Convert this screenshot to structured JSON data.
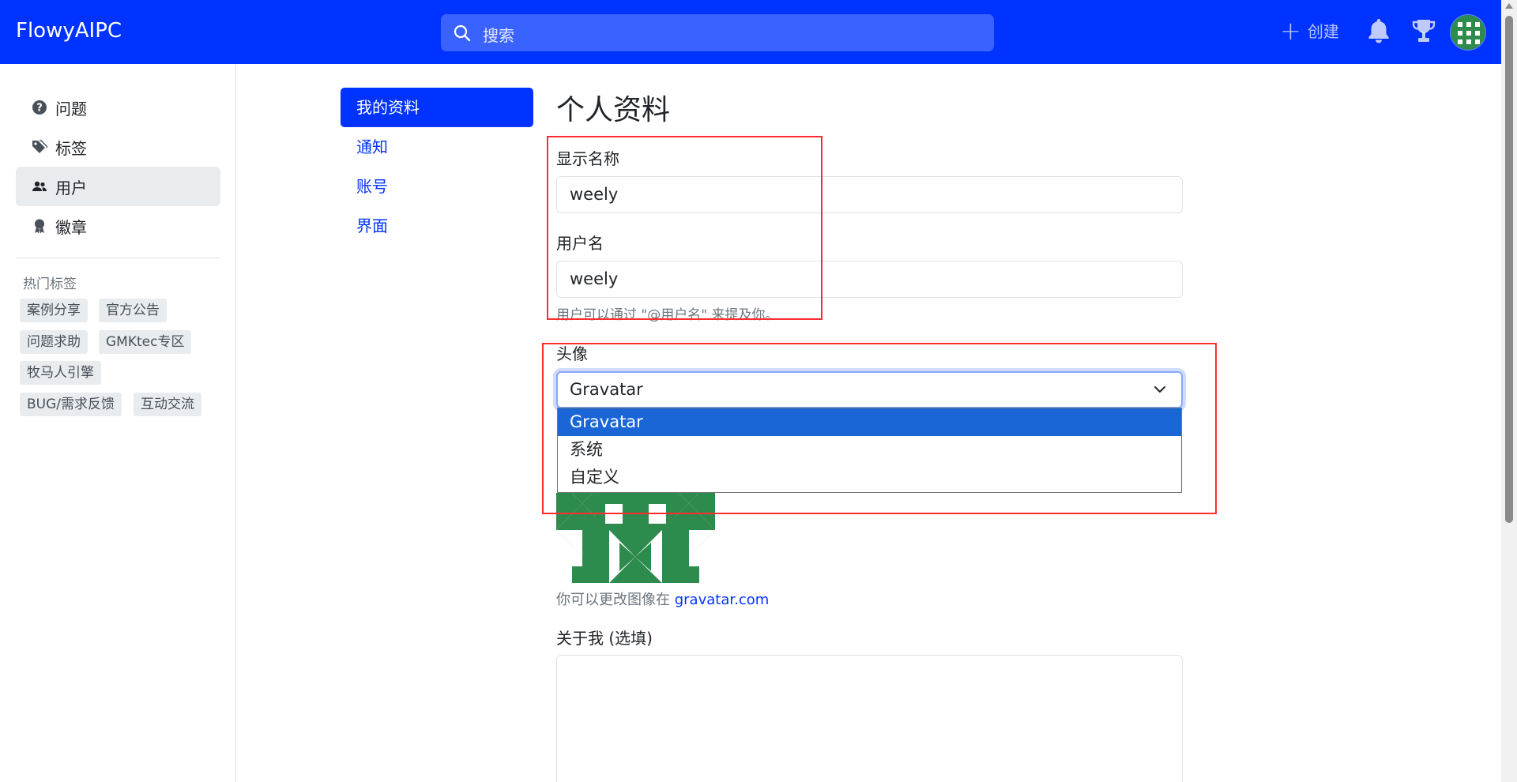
{
  "header": {
    "brand": "FlowyAIPC",
    "search_placeholder": "搜索",
    "create_label": "创建",
    "bar_color": "#0033ff"
  },
  "sidebar": {
    "items": [
      {
        "label": "问题",
        "icon": "question-circle-icon"
      },
      {
        "label": "标签",
        "icon": "tags-icon"
      },
      {
        "label": "用户",
        "icon": "people-icon",
        "active": true
      },
      {
        "label": "徽章",
        "icon": "award-icon"
      }
    ],
    "hot_tags_title": "热门标签",
    "hot_tags": [
      "案例分享",
      "官方公告",
      "问题求助",
      "GMKtec专区",
      "牧马人引擎",
      "BUG/需求反馈",
      "互动交流"
    ]
  },
  "settings_nav": {
    "items": [
      {
        "label": "我的资料",
        "active": true
      },
      {
        "label": "通知"
      },
      {
        "label": "账号"
      },
      {
        "label": "界面"
      }
    ]
  },
  "profile": {
    "title": "个人资料",
    "display_name_label": "显示名称",
    "display_name_value": "weely",
    "username_label": "用户名",
    "username_value": "weely",
    "username_hint": "用户可以通过 \"@用户名\" 来提及你。",
    "avatar_label": "头像",
    "avatar_selected": "Gravatar",
    "avatar_options": [
      "Gravatar",
      "系统",
      "自定义"
    ],
    "gravatar_hint": "你可以更改图像在",
    "gravatar_link": "gravatar.com",
    "about_label": "关于我 (选填)",
    "about_value": ""
  }
}
